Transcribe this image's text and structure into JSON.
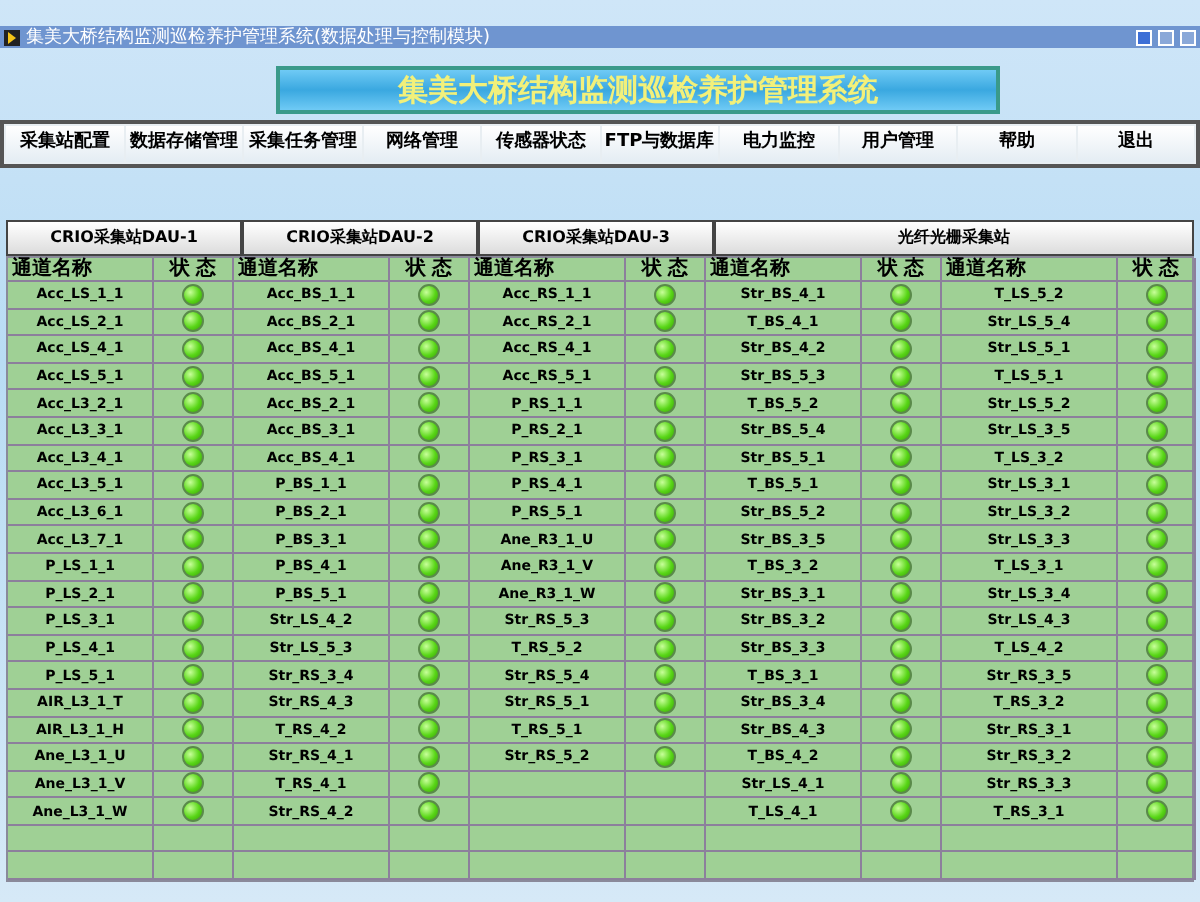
{
  "window": {
    "title": "集美大桥结构监测巡检养护管理系统(数据处理与控制模块)"
  },
  "banner": {
    "title": "集美大桥结构监测巡检养护管理系统"
  },
  "menu": [
    "采集站配置",
    "数据存储管理",
    "采集任务管理",
    "网络管理",
    "传感器状态",
    "FTP与数据库",
    "电力监控",
    "用户管理",
    "帮助",
    "退出"
  ],
  "tabs": [
    {
      "label": "CRIO采集站DAU-1",
      "selected": false
    },
    {
      "label": "CRIO采集站DAU-2",
      "selected": false
    },
    {
      "label": "CRIO采集站DAU-3",
      "selected": false
    },
    {
      "label": "光纤光栅采集站",
      "selected": false
    }
  ],
  "groups": [
    {
      "name_header": "通道名称",
      "status_header": "状 态",
      "rows": [
        {
          "name": "Acc_LS_1_1",
          "on": true
        },
        {
          "name": "Acc_LS_2_1",
          "on": true
        },
        {
          "name": "Acc_LS_4_1",
          "on": true
        },
        {
          "name": "Acc_LS_5_1",
          "on": true
        },
        {
          "name": "Acc_L3_2_1",
          "on": true
        },
        {
          "name": "Acc_L3_3_1",
          "on": true
        },
        {
          "name": "Acc_L3_4_1",
          "on": true
        },
        {
          "name": "Acc_L3_5_1",
          "on": true
        },
        {
          "name": "Acc_L3_6_1",
          "on": true
        },
        {
          "name": "Acc_L3_7_1",
          "on": true
        },
        {
          "name": "P_LS_1_1",
          "on": true
        },
        {
          "name": "P_LS_2_1",
          "on": true
        },
        {
          "name": "P_LS_3_1",
          "on": true
        },
        {
          "name": "P_LS_4_1",
          "on": true
        },
        {
          "name": "P_LS_5_1",
          "on": true
        },
        {
          "name": "AIR_L3_1_T",
          "on": true
        },
        {
          "name": "AIR_L3_1_H",
          "on": true
        },
        {
          "name": "Ane_L3_1_U",
          "on": true
        },
        {
          "name": "Ane_L3_1_V",
          "on": true
        },
        {
          "name": "Ane_L3_1_W",
          "on": true
        }
      ]
    },
    {
      "name_header": "通道名称",
      "status_header": "状 态",
      "rows": [
        {
          "name": "Acc_BS_1_1",
          "on": true
        },
        {
          "name": "Acc_BS_2_1",
          "on": true
        },
        {
          "name": "Acc_BS_4_1",
          "on": true
        },
        {
          "name": "Acc_BS_5_1",
          "on": true
        },
        {
          "name": "Acc_BS_2_1",
          "on": true
        },
        {
          "name": "Acc_BS_3_1",
          "on": true
        },
        {
          "name": "Acc_BS_4_1",
          "on": true
        },
        {
          "name": "P_BS_1_1",
          "on": true
        },
        {
          "name": "P_BS_2_1",
          "on": true
        },
        {
          "name": "P_BS_3_1",
          "on": true
        },
        {
          "name": "P_BS_4_1",
          "on": true
        },
        {
          "name": "P_BS_5_1",
          "on": true
        },
        {
          "name": "Str_LS_4_2",
          "on": true
        },
        {
          "name": "Str_LS_5_3",
          "on": true
        },
        {
          "name": "Str_RS_3_4",
          "on": true
        },
        {
          "name": "Str_RS_4_3",
          "on": true
        },
        {
          "name": "T_RS_4_2",
          "on": true
        },
        {
          "name": "Str_RS_4_1",
          "on": true
        },
        {
          "name": "T_RS_4_1",
          "on": true
        },
        {
          "name": "Str_RS_4_2",
          "on": true
        }
      ]
    },
    {
      "name_header": "通道名称",
      "status_header": "状 态",
      "rows": [
        {
          "name": "Acc_RS_1_1",
          "on": true
        },
        {
          "name": "Acc_RS_2_1",
          "on": true
        },
        {
          "name": "Acc_RS_4_1",
          "on": true
        },
        {
          "name": "Acc_RS_5_1",
          "on": true
        },
        {
          "name": "P_RS_1_1",
          "on": true
        },
        {
          "name": "P_RS_2_1",
          "on": true
        },
        {
          "name": "P_RS_3_1",
          "on": true
        },
        {
          "name": "P_RS_4_1",
          "on": true
        },
        {
          "name": "P_RS_5_1",
          "on": true
        },
        {
          "name": "Ane_R3_1_U",
          "on": true
        },
        {
          "name": "Ane_R3_1_V",
          "on": true
        },
        {
          "name": "Ane_R3_1_W",
          "on": true
        },
        {
          "name": "Str_RS_5_3",
          "on": true
        },
        {
          "name": "T_RS_5_2",
          "on": true
        },
        {
          "name": "Str_RS_5_4",
          "on": true
        },
        {
          "name": "Str_RS_5_1",
          "on": true
        },
        {
          "name": "T_RS_5_1",
          "on": true
        },
        {
          "name": "Str_RS_5_2",
          "on": true
        }
      ]
    },
    {
      "name_header": "通道名称",
      "status_header": "状 态",
      "rows": [
        {
          "name": "Str_BS_4_1",
          "on": true
        },
        {
          "name": "T_BS_4_1",
          "on": true
        },
        {
          "name": "Str_BS_4_2",
          "on": true
        },
        {
          "name": "Str_BS_5_3",
          "on": true
        },
        {
          "name": "T_BS_5_2",
          "on": true
        },
        {
          "name": "Str_BS_5_4",
          "on": true
        },
        {
          "name": "Str_BS_5_1",
          "on": true
        },
        {
          "name": "T_BS_5_1",
          "on": true
        },
        {
          "name": "Str_BS_5_2",
          "on": true
        },
        {
          "name": "Str_BS_3_5",
          "on": true
        },
        {
          "name": "T_BS_3_2",
          "on": true
        },
        {
          "name": "Str_BS_3_1",
          "on": true
        },
        {
          "name": "Str_BS_3_2",
          "on": true
        },
        {
          "name": "Str_BS_3_3",
          "on": true
        },
        {
          "name": "T_BS_3_1",
          "on": true
        },
        {
          "name": "Str_BS_3_4",
          "on": true
        },
        {
          "name": "Str_BS_4_3",
          "on": true
        },
        {
          "name": "T_BS_4_2",
          "on": true
        },
        {
          "name": "Str_LS_4_1",
          "on": true
        },
        {
          "name": "T_LS_4_1",
          "on": true
        }
      ]
    },
    {
      "name_header": "通道名称",
      "status_header": "状 态",
      "rows": [
        {
          "name": "T_LS_5_2",
          "on": true
        },
        {
          "name": "Str_LS_5_4",
          "on": true
        },
        {
          "name": "Str_LS_5_1",
          "on": true
        },
        {
          "name": "T_LS_5_1",
          "on": true
        },
        {
          "name": "Str_LS_5_2",
          "on": true
        },
        {
          "name": "Str_LS_3_5",
          "on": true
        },
        {
          "name": "T_LS_3_2",
          "on": true
        },
        {
          "name": "Str_LS_3_1",
          "on": true
        },
        {
          "name": "Str_LS_3_2",
          "on": true
        },
        {
          "name": "Str_LS_3_3",
          "on": true
        },
        {
          "name": "T_LS_3_1",
          "on": true
        },
        {
          "name": "Str_LS_3_4",
          "on": true
        },
        {
          "name": "Str_LS_4_3",
          "on": true
        },
        {
          "name": "T_LS_4_2",
          "on": true
        },
        {
          "name": "Str_RS_3_5",
          "on": true
        },
        {
          "name": "T_RS_3_2",
          "on": true
        },
        {
          "name": "Str_RS_3_1",
          "on": true
        },
        {
          "name": "Str_RS_3_2",
          "on": true
        },
        {
          "name": "Str_RS_3_3",
          "on": true
        },
        {
          "name": "T_RS_3_1",
          "on": true
        }
      ]
    }
  ]
}
